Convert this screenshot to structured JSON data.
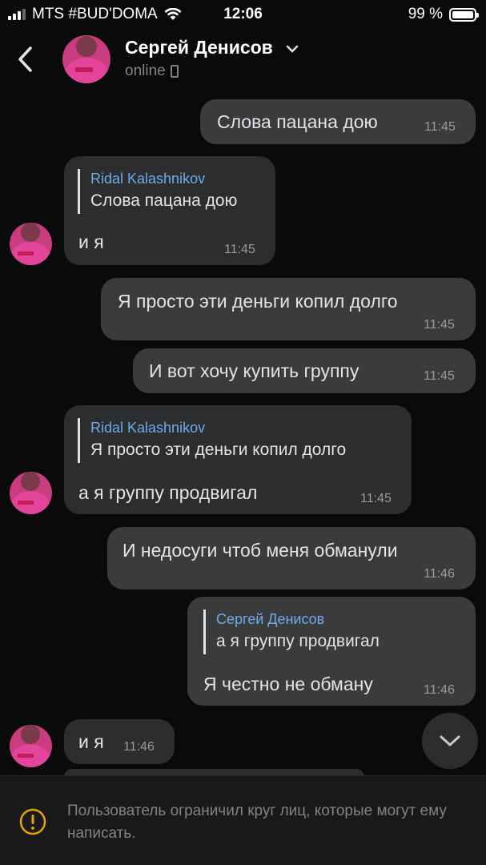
{
  "status_bar": {
    "carrier": "MTS #BUD'DOMA",
    "time": "12:06",
    "battery": "99 %"
  },
  "header": {
    "name": "Сергей Денисов",
    "status": "online"
  },
  "messages": [
    {
      "text": "Слова пацана дою",
      "time": "11:45"
    },
    {
      "reply_author": "Ridal Kalashnikov",
      "reply_text": "Слова пацана дою",
      "text": "и я",
      "time": "11:45"
    },
    {
      "text": "Я просто эти деньги копил долго",
      "time": "11:45"
    },
    {
      "text": "И вот хочу купить группу",
      "time": "11:45"
    },
    {
      "reply_author": "Ridal Kalashnikov",
      "reply_text": "Я просто эти деньги копил долго",
      "text": "а я группу продвигал",
      "time": "11:45"
    },
    {
      "text": "И недосуги чтоб меня обманули",
      "time": "11:46"
    },
    {
      "reply_author": "Сергей Денисов",
      "reply_text": "а я группу продвигал",
      "text": "Я честно не обману",
      "time": "11:46"
    },
    {
      "text": "и я",
      "time": "11:46"
    }
  ],
  "footer": {
    "notice": "Пользователь ограничил круг лиц, которые могут ему написать."
  },
  "colors": {
    "background": "#0a0a0a",
    "bubble_in": "#2c2d2e",
    "bubble_out": "#3a3b3c",
    "reply_author": "#71aaeb",
    "avatar_pink": "#d63a8c"
  },
  "icons": {
    "back": "chevron-left-icon",
    "header_dropdown": "chevron-down-icon",
    "status_device": "phone-icon",
    "scroll": "chevron-down-icon",
    "notice": "warning-icon"
  }
}
